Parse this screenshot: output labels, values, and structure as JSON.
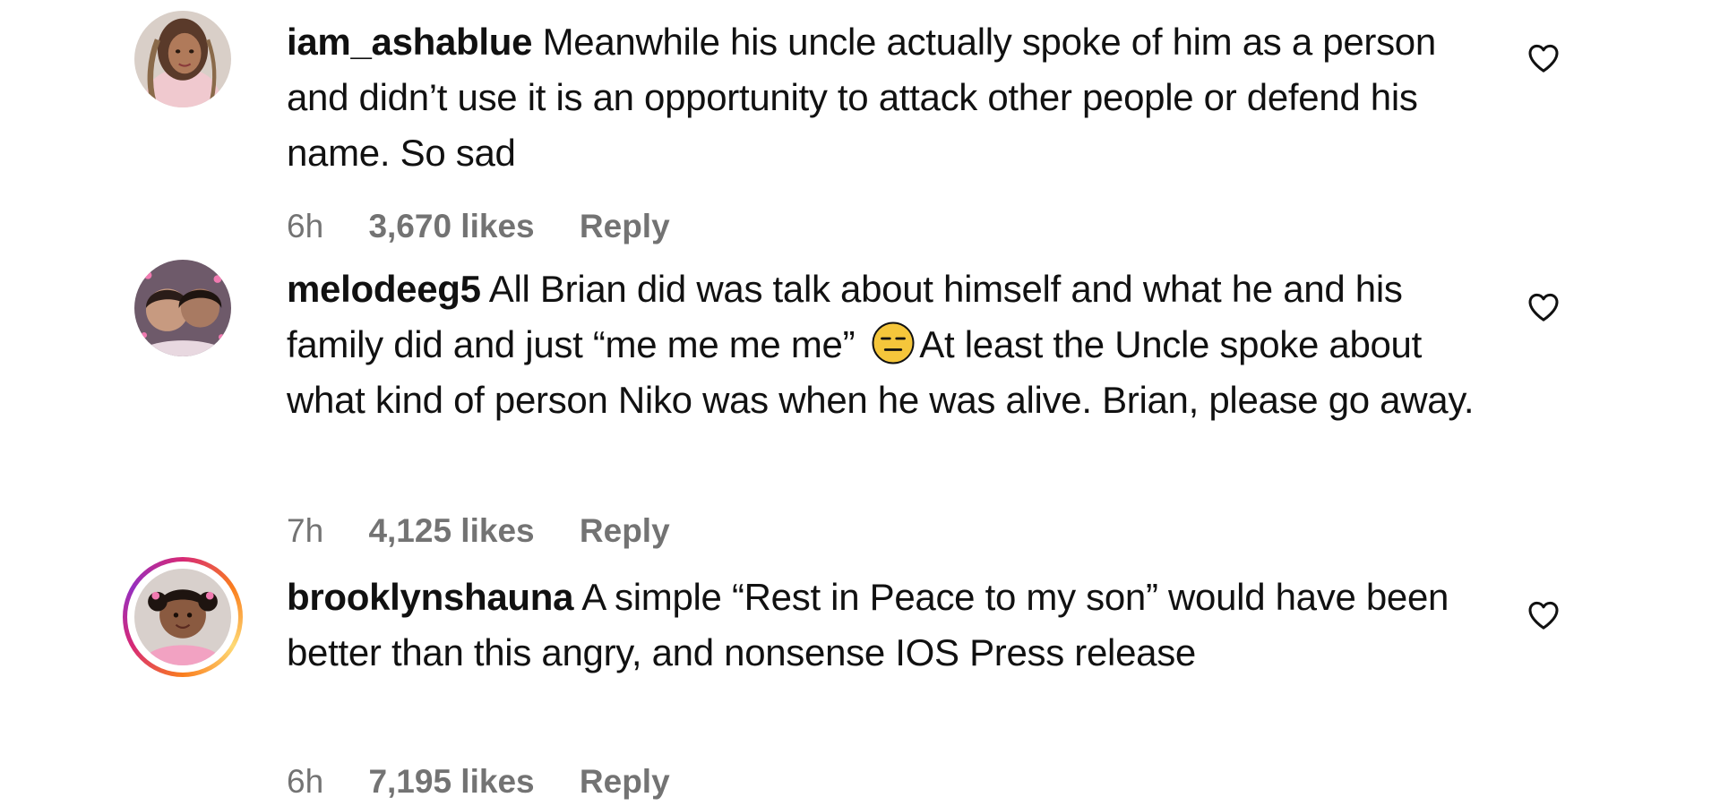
{
  "comments": [
    {
      "username": "iam_ashablue",
      "text": "Meanwhile his uncle actually spoke of him as a person and didn’t use it is an opportunity to attack other people or defend his name. So sad",
      "time": "6h",
      "likes": "3,670 likes",
      "reply_label": "Reply",
      "avatar_icon": "user-photo-avatar",
      "like_icon": "heart-outline-icon"
    },
    {
      "username": "melodeeg5",
      "text_before_emoji": "All Brian did was talk about himself and what he and his family did and just “me me me me”",
      "emoji": "expressionless-face",
      "text_after_emoji": "At least the Uncle spoke about what kind of person Niko was when he was alive. Brian, please go away.",
      "time": "7h",
      "likes": "4,125 likes",
      "reply_label": "Reply",
      "avatar_icon": "user-photo-avatar",
      "like_icon": "heart-outline-icon"
    },
    {
      "username": "brooklynshauna",
      "text": "A simple “Rest in Peace to my son” would have been better than this angry, and nonsense IOS Press release",
      "time": "6h",
      "likes": "7,195 likes",
      "reply_label": "Reply",
      "avatar_icon": "user-photo-avatar-story-ring",
      "like_icon": "heart-outline-icon"
    }
  ],
  "colors": {
    "text": "#111111",
    "meta": "#737373",
    "story_ring_start": "#d62976",
    "story_ring_end": "#feda75",
    "emoji": "#f5c63b"
  }
}
